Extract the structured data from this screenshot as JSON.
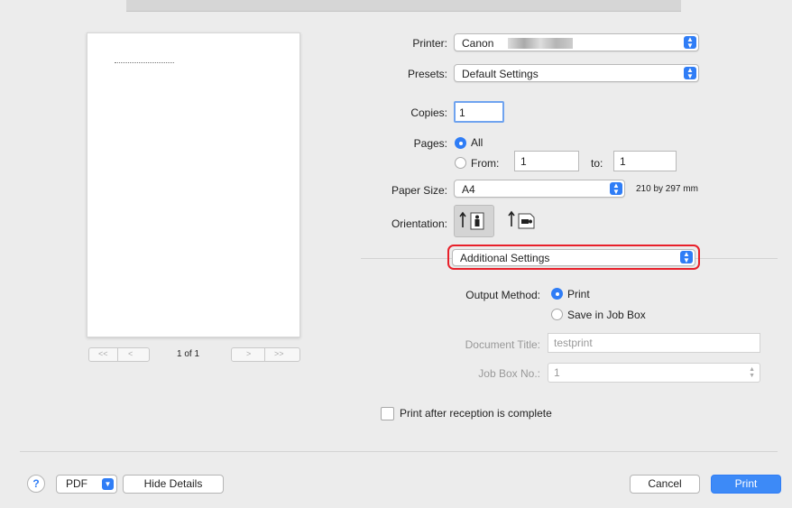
{
  "printer": {
    "label": "Printer:",
    "value": "Canon"
  },
  "presets": {
    "label": "Presets:",
    "value": "Default Settings"
  },
  "copies": {
    "label": "Copies:",
    "value": "1"
  },
  "pages": {
    "label": "Pages:",
    "all_label": "All",
    "from_label": "From:",
    "from_value": "1",
    "to_label": "to:",
    "to_value": "1",
    "selected": "All"
  },
  "paper_size": {
    "label": "Paper Size:",
    "value": "A4",
    "dimensions": "210 by 297 mm"
  },
  "orientation": {
    "label": "Orientation:",
    "selected": "portrait"
  },
  "section_popup": {
    "value": "Additional Settings"
  },
  "output_method": {
    "label": "Output Method:",
    "print_label": "Print",
    "save_label": "Save in Job Box",
    "selected": "Print"
  },
  "document_title": {
    "label": "Document Title:",
    "value": "testprint"
  },
  "job_box": {
    "label": "Job Box No.:",
    "value": "1"
  },
  "print_after": {
    "label": "Print after reception is complete",
    "checked": false
  },
  "preview": {
    "page_indicator": "1 of 1",
    "first": "<<",
    "prev": "<",
    "next": ">",
    "last": ">>"
  },
  "bottom": {
    "help": "?",
    "pdf": "PDF",
    "hide_details": "Hide Details",
    "cancel": "Cancel",
    "print": "Print"
  },
  "colors": {
    "accent": "#2f7df6",
    "highlight": "#e8202a",
    "dialog_bg": "#ececec"
  }
}
